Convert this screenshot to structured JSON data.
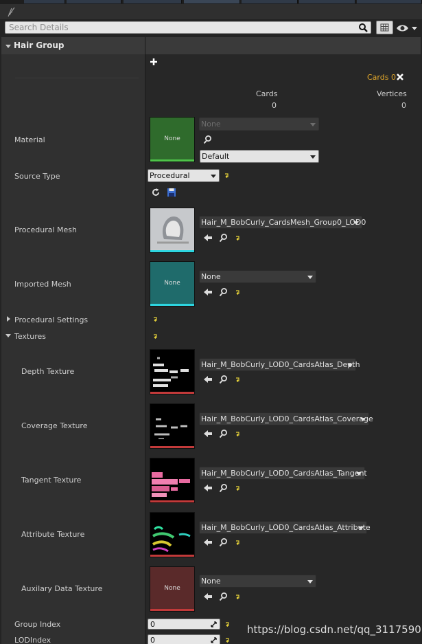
{
  "search": {
    "placeholder": "Search Details"
  },
  "section": {
    "title": "Hair Group"
  },
  "cards_badge": {
    "label": "Cards 0"
  },
  "table": {
    "cards_header": "Cards",
    "cards_value": "0",
    "vertices_header": "Vertices",
    "vertices_value": "0"
  },
  "material": {
    "label": "Material",
    "thumb_text": "None",
    "combo_none": "None",
    "combo_default": "Default"
  },
  "source_type": {
    "label": "Source Type",
    "value": "Procedural"
  },
  "procedural_mesh": {
    "label": "Procedural Mesh",
    "value": "Hair_M_BobCurly_CardsMesh_Group0_LOD0"
  },
  "imported_mesh": {
    "label": "Imported Mesh",
    "thumb_text": "None",
    "value": "None"
  },
  "procedural_settings": {
    "label": "Procedural Settings"
  },
  "textures": {
    "label": "Textures",
    "items": [
      {
        "label": "Depth Texture",
        "value": "Hair_M_BobCurly_LOD0_CardsAtlas_Depth"
      },
      {
        "label": "Coverage Texture",
        "value": "Hair_M_BobCurly_LOD0_CardsAtlas_Coverage"
      },
      {
        "label": "Tangent Texture",
        "value": "Hair_M_BobCurly_LOD0_CardsAtlas_Tangent"
      },
      {
        "label": "Attribute Texture",
        "value": "Hair_M_BobCurly_LOD0_CardsAtlas_Attribute"
      },
      {
        "label": "Auxilary Data Texture",
        "value": "None",
        "thumb_text": "None"
      }
    ]
  },
  "group_index": {
    "label": "Group Index",
    "value": "0"
  },
  "lod_index": {
    "label": "LODIndex",
    "value": "0"
  },
  "watermark": "https://blog.csdn.net/qq_31175907",
  "colors": {
    "accent_orange": "#e3a82b",
    "reset_yellow": "#e6d23a",
    "material_green": "#2f6b2c",
    "imported_teal": "#1f6b6b",
    "aux_red": "#5a2a2a"
  }
}
